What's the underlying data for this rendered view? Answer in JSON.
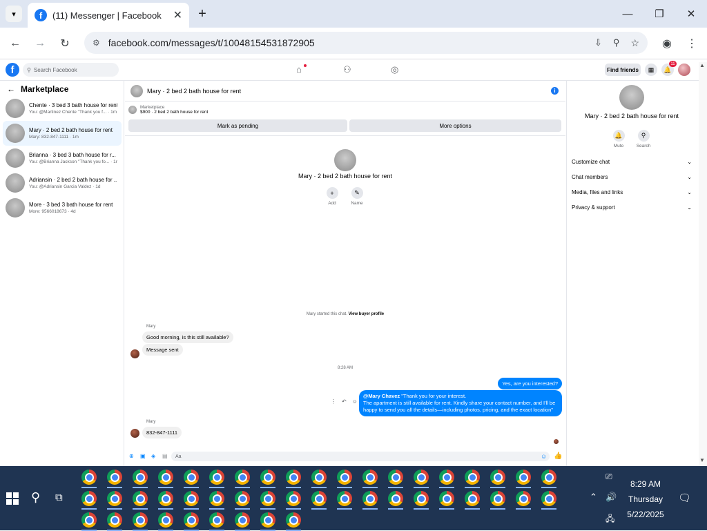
{
  "browser": {
    "tab_title": "(11) Messenger | Facebook",
    "url": "facebook.com/messages/t/10048154531872905"
  },
  "fb": {
    "search_placeholder": "Search Facebook",
    "find_friends": "Find friends",
    "notif_count": "11"
  },
  "sidebar": {
    "title": "Marketplace",
    "items": [
      {
        "title": "Chente · 3 bed 3 bath house for rent",
        "preview": "You: @Martinez Chente \"Thank you f... · 1m"
      },
      {
        "title": "Mary · 2 bed 2 bath house for rent",
        "preview": "Mary: 832-847-1111 · 1m"
      },
      {
        "title": "Brianna · 3 bed 3 bath house for r...",
        "preview": "You: @Brianna Jackson \"Thank you fo... · 1m"
      },
      {
        "title": "Adriansin · 2 bed 2 bath house for ...",
        "preview": "You: @Adriansin Garcia Valdez · 1d"
      },
      {
        "title": "More · 3 bed 3 bath house for rent",
        "preview": "More: 9566018673 · 4d"
      }
    ]
  },
  "chat": {
    "header_title": "Mary · 2 bed 2 bath house for rent",
    "marketplace_label": "Marketplace",
    "listing": "$900 · 2 bed 2 bath house for rent",
    "mark_pending": "Mark as pending",
    "more_options": "More options",
    "profile_name": "Mary · 2 bed 2 bath house for rent",
    "add_label": "Add",
    "name_label": "Name",
    "started_text": "Mary started this chat.",
    "view_buyer": "View buyer profile",
    "sender1": "Mary",
    "msg1": "Good morning, is this still available?",
    "msg2": "Message sent",
    "time1": "8:28 AM",
    "reply1": "Yes, are you interested?",
    "reply2_mention": "@Mary Chavez",
    "reply2_line1": "\"Thank you for your interest.",
    "reply2_line2": "The apartment is still available for rent. Kindly share your contact number, and I'll be",
    "reply2_line3": "happy to send you all the details—including photos, pricing, and the exact location\"",
    "sender2": "Mary",
    "msg3": "832-847-1111",
    "composer_placeholder": "Aa"
  },
  "panel": {
    "name": "Mary · 2 bed 2 bath house for rent",
    "mute": "Mute",
    "search": "Search",
    "sections": [
      "Customize chat",
      "Chat members",
      "Media, files and links",
      "Privacy & support"
    ]
  },
  "taskbar": {
    "time": "8:29 AM",
    "day": "Thursday",
    "date": "5/22/2025"
  }
}
